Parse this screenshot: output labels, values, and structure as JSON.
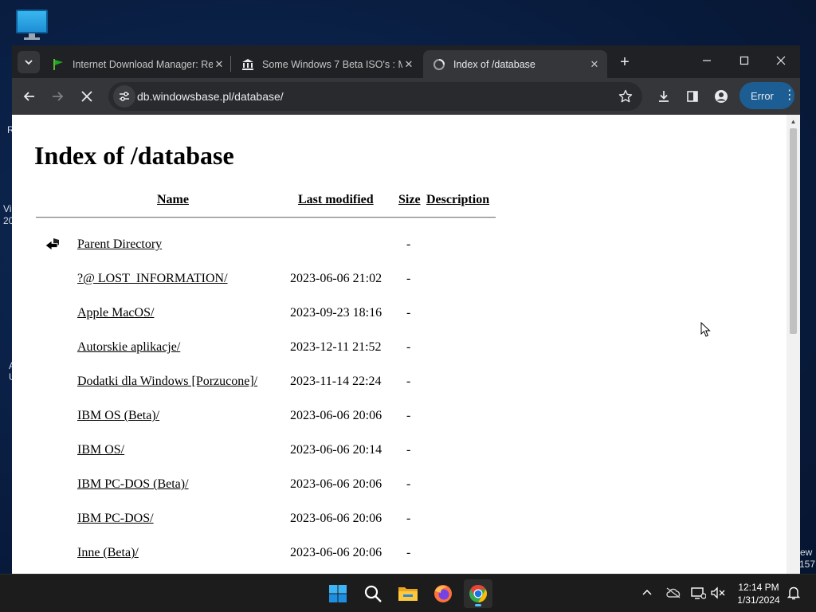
{
  "desktop": {
    "icon_name": "monitor-icon",
    "fragments": [
      "R",
      "Vi",
      "20",
      "A",
      "U",
      "ew",
      "157"
    ]
  },
  "browser": {
    "tabs": [
      {
        "title": "Internet Download Manager: Re",
        "favicon": "green-flag-icon",
        "active": false
      },
      {
        "title": "Some Windows 7 Beta ISO's : M",
        "favicon": "bank-icon",
        "active": false
      },
      {
        "title": "Index of /database",
        "favicon": "loading-icon",
        "active": true
      }
    ],
    "address": "db.windowsbase.pl/database/",
    "error_label": "Error"
  },
  "page": {
    "heading": "Index of /database",
    "columns": {
      "name": "Name",
      "modified": "Last modified",
      "size": "Size",
      "description": "Description"
    },
    "rows": [
      {
        "name": "Parent Directory",
        "modified": "",
        "size": "-",
        "icon": "back-arrow-icon"
      },
      {
        "name": "?@ LOST_INFORMATION/",
        "modified": "2023-06-06 21:02",
        "size": "-"
      },
      {
        "name": "Apple MacOS/",
        "modified": "2023-09-23 18:16",
        "size": "-"
      },
      {
        "name": "Autorskie aplikacje/",
        "modified": "2023-12-11 21:52",
        "size": "-"
      },
      {
        "name": "Dodatki dla Windows [Porzucone]/",
        "modified": "2023-11-14 22:24",
        "size": "-"
      },
      {
        "name": "IBM OS (Beta)/",
        "modified": "2023-06-06 20:06",
        "size": "-"
      },
      {
        "name": "IBM OS/",
        "modified": "2023-06-06 20:14",
        "size": "-"
      },
      {
        "name": "IBM PC-DOS (Beta)/",
        "modified": "2023-06-06 20:06",
        "size": "-"
      },
      {
        "name": "IBM PC-DOS/",
        "modified": "2023-06-06 20:06",
        "size": "-"
      },
      {
        "name": "Inne (Beta)/",
        "modified": "2023-06-06 20:06",
        "size": "-"
      }
    ]
  },
  "taskbar": {
    "apps": [
      "windows-start-icon",
      "search-icon",
      "file-explorer-icon",
      "firefox-icon",
      "chrome-icon"
    ],
    "time": "12:14 PM",
    "date": "1/31/2024"
  },
  "colors": {
    "accent": "#4cc2ff",
    "error_button": "#1c5e93",
    "chrome_dark": "#202124"
  }
}
